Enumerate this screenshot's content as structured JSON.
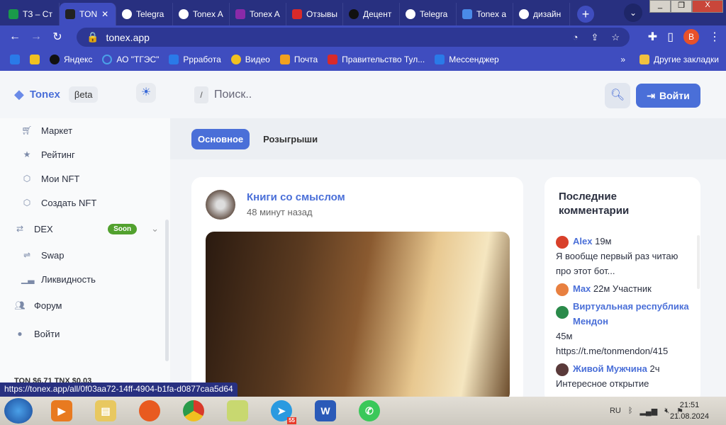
{
  "browser": {
    "tabs": [
      {
        "title": "ТЗ – Ст",
        "color": "#1a9a4a"
      },
      {
        "title": "TON",
        "color": "#222"
      },
      {
        "title": "Telegra",
        "color": "#fff"
      },
      {
        "title": "Tonex A",
        "color": "#fff"
      },
      {
        "title": "Tonex A",
        "color": "#8a2aa8"
      },
      {
        "title": "Отзывы",
        "color": "#d82a2a"
      },
      {
        "title": "Децент",
        "color": "#111"
      },
      {
        "title": "Telegra",
        "color": "#fff"
      },
      {
        "title": "Tonex a",
        "color": "#4a8ae8"
      },
      {
        "title": "дизайн",
        "color": "#fff"
      }
    ],
    "url": "tonex.app",
    "profile_initial": "B",
    "bookmarks": [
      "Яндекс",
      "АО \"ТГЭС\"",
      "Ррработа",
      "Видео",
      "Почта",
      "Правительство Тул...",
      "Мессенджер"
    ],
    "other_bookmarks": "Другие закладки"
  },
  "sidebar": {
    "logo": "Tonex",
    "beta": "βeta",
    "items": [
      "Маркет",
      "Рейтинг",
      "Мои NFT",
      "Создать NFT"
    ],
    "dex": "DEX",
    "soon": "Soon",
    "dex_items": [
      "Swap",
      "Ликвидность"
    ],
    "forum": "Форум",
    "login": "Войти",
    "prices": "TON $6.71  TNX $0.03"
  },
  "header": {
    "slash": "/",
    "search_placeholder": "Поиск..",
    "login": "Войти"
  },
  "tabs": [
    "Основное",
    "Розыгрыши"
  ],
  "post": {
    "title": "Книги со смыслом",
    "time": "48 минут назад"
  },
  "comments": {
    "title": "Последние комментарии",
    "items": [
      {
        "user": "Alex",
        "meta": "19м",
        "text": "Я вообще первый раз читаю про этот бот..."
      },
      {
        "user": "Max",
        "meta": "22м Участник",
        "text": ""
      },
      {
        "user": "Виртуальная республика Мендон",
        "meta": "45м",
        "text": "https://t.me/tonmendon/415"
      },
      {
        "user": "Живой Мужчина",
        "meta": "2ч",
        "text": "Интересное открытие"
      }
    ]
  },
  "status_url": "https://tonex.app/all/0f03aa72-14ff-4904-b1fa-d0877caa5d64",
  "taskbar": {
    "lang": "RU",
    "time": "21:51",
    "date": "21.08.2024",
    "telegram_badge": "55"
  }
}
